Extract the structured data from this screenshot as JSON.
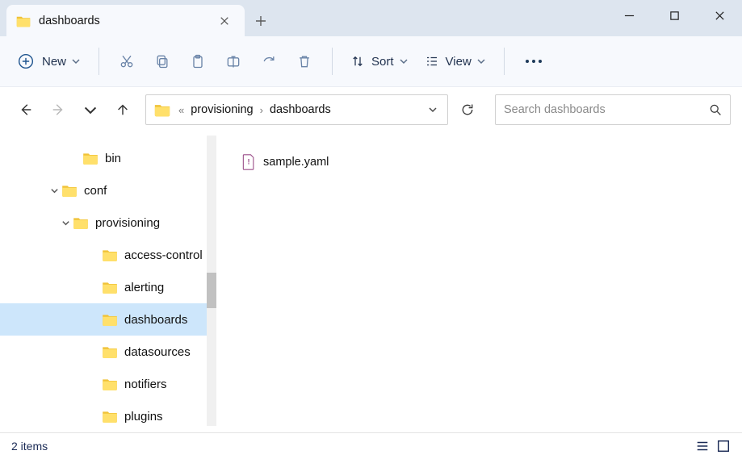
{
  "tab": {
    "title": "dashboards"
  },
  "toolbar": {
    "new_label": "New",
    "sort_label": "Sort",
    "view_label": "View"
  },
  "breadcrumb": {
    "segments": [
      "provisioning",
      "dashboards"
    ]
  },
  "search": {
    "placeholder": "Search dashboards"
  },
  "tree": {
    "items": [
      {
        "label": "bin",
        "indent": "ind0",
        "chev": "",
        "sel": false
      },
      {
        "label": "conf",
        "indent": "ind0c",
        "chev": "v",
        "sel": false
      },
      {
        "label": "provisioning",
        "indent": "ind1c",
        "chev": "v",
        "sel": false
      },
      {
        "label": "access-control",
        "indent": "ind2",
        "chev": "",
        "sel": false
      },
      {
        "label": "alerting",
        "indent": "ind2",
        "chev": "",
        "sel": false
      },
      {
        "label": "dashboards",
        "indent": "ind2",
        "chev": "",
        "sel": true
      },
      {
        "label": "datasources",
        "indent": "ind2",
        "chev": "",
        "sel": false
      },
      {
        "label": "notifiers",
        "indent": "ind2",
        "chev": "",
        "sel": false
      },
      {
        "label": "plugins",
        "indent": "ind2",
        "chev": "",
        "sel": false
      }
    ]
  },
  "content": {
    "files": [
      {
        "name": "sample.yaml"
      }
    ]
  },
  "status": {
    "text": "2 items"
  }
}
